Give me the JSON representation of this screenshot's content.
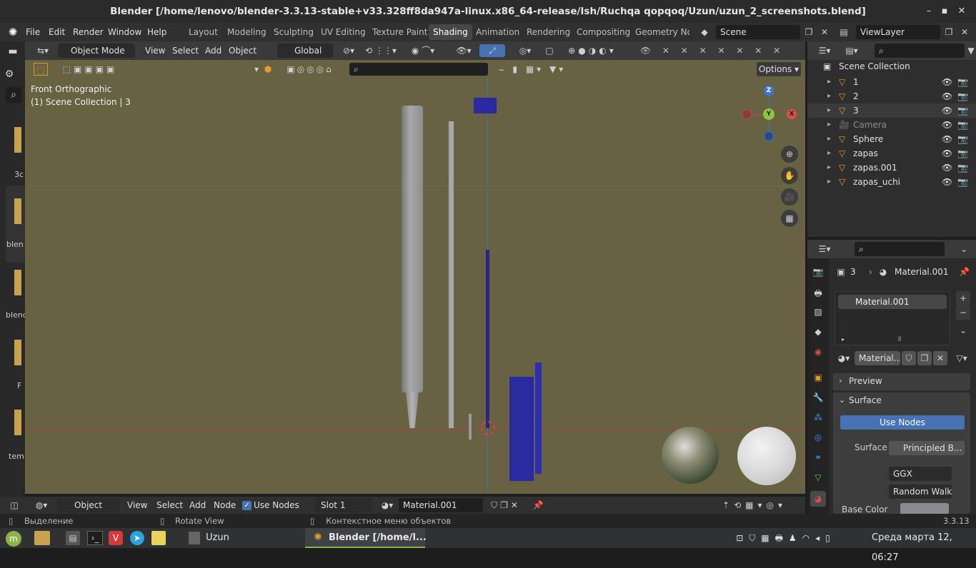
{
  "window": {
    "title": "Blender [/home/lenovo/blender-3.3.13-stable+v33.328ff8da947a-linux.x86_64-release/Ish/Ruchqa qopqoq/Uzun/uzun_2_screenshots.blend]",
    "minimize": "–",
    "maximize": "▪",
    "close": "✕"
  },
  "menu": {
    "file": "File",
    "edit": "Edit",
    "render": "Render",
    "window": "Window",
    "help": "Help"
  },
  "workspaces": [
    "Layout",
    "Modeling",
    "Sculpting",
    "UV Editing",
    "Texture Paint",
    "Shading",
    "Animation",
    "Rendering",
    "Compositing",
    "Geometry Noc"
  ],
  "active_workspace": "Shading",
  "scene": {
    "label": "Scene",
    "viewlayer": "ViewLayer"
  },
  "viewport_header": {
    "mode": "Object Mode",
    "view": "View",
    "select": "Select",
    "add": "Add",
    "object": "Object",
    "transform": "Global",
    "options": "Options"
  },
  "viewport": {
    "view_name": "Front Orthographic",
    "collection_info": "(1) Scene Collection | 3",
    "gizmo": {
      "z": "Z",
      "y": "Y",
      "x": "X"
    }
  },
  "left_sidebar": {
    "labels": [
      "3c",
      "blen",
      "blend",
      "F",
      "tem"
    ]
  },
  "outliner": {
    "root": "Scene Collection",
    "items": [
      {
        "name": "1",
        "type": "mesh"
      },
      {
        "name": "2",
        "type": "mesh"
      },
      {
        "name": "3",
        "type": "mesh"
      },
      {
        "name": "Camera",
        "type": "camera"
      },
      {
        "name": "Sphere",
        "type": "mesh"
      },
      {
        "name": "zapas",
        "type": "mesh"
      },
      {
        "name": "zapas.001",
        "type": "mesh"
      },
      {
        "name": "zapas_uchi",
        "type": "mesh"
      }
    ]
  },
  "properties": {
    "breadcrumb_object": "3",
    "breadcrumb_material": "Material.001",
    "slot_name": "Material.001",
    "material_field": "Material...",
    "preview": "Preview",
    "surface": "Surface",
    "use_nodes": "Use Nodes",
    "surface_label": "Surface",
    "surface_value": "Principled B...",
    "distribution": "GGX",
    "subsurface": "Random Walk",
    "base_color_label": "Base Color"
  },
  "node_header": {
    "object": "Object",
    "view": "View",
    "select": "Select",
    "add": "Add",
    "node": "Node",
    "use_nodes": "Use Nodes",
    "slot": "Slot 1",
    "material": "Material.001"
  },
  "statusbar": {
    "select": "Выделение",
    "rotate": "Rotate View",
    "context": "Контекстное меню объектов",
    "version": "3.3.13"
  },
  "taskbar": {
    "uzun": "Uzun",
    "blender": "Blender [/home/l...",
    "clock": "Среда марта 12, 06:27"
  },
  "colors": {
    "viewport_bg": "#666242",
    "accent_blue": "#4772b3",
    "active_tab": "#474747",
    "pen_blue": "#2a2aa0",
    "gizmo_x": "#e34a4a",
    "gizmo_y": "#8cc63f",
    "gizmo_z": "#3b78d1"
  }
}
